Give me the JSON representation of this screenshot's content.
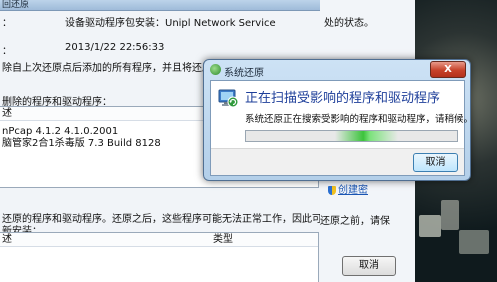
{
  "left_window": {
    "title": "回还原",
    "line1_label": "：",
    "line1_value": "设备驱动程序包安装：Unipl Network Service",
    "line2_label": "：",
    "line2_value": "2013/1/22 22:56:33",
    "line3": "除自上次还原点后添加的所有程序，并且将还原已删",
    "section1_title": "删除的程序和驱动程序：",
    "table1_header": "述",
    "table1_rows": [
      "nPcap 4.1.2 4.1.0.2001",
      "脑管家2合1杀毒版 7.3 Build 8128"
    ],
    "section2_line1": "还原的程序和驱动程序。还原之后，这些程序可能无法正常工作，因此可能需",
    "section2_line2": "新安装：",
    "table2_header_col1": "述",
    "table2_header_col2": "类型"
  },
  "right_window": {
    "top_text": "处的状态。",
    "link_text": "创建密",
    "before_text": "还原之前，请保",
    "cancel_label": "取消"
  },
  "dialog": {
    "title": "系统还原",
    "close_label": "X",
    "heading": "正在扫描受影响的程序和驱动程序",
    "description": "系统还原正在搜索受影响的程序和驱动程序，请稍候。",
    "cancel_label": "取消"
  }
}
